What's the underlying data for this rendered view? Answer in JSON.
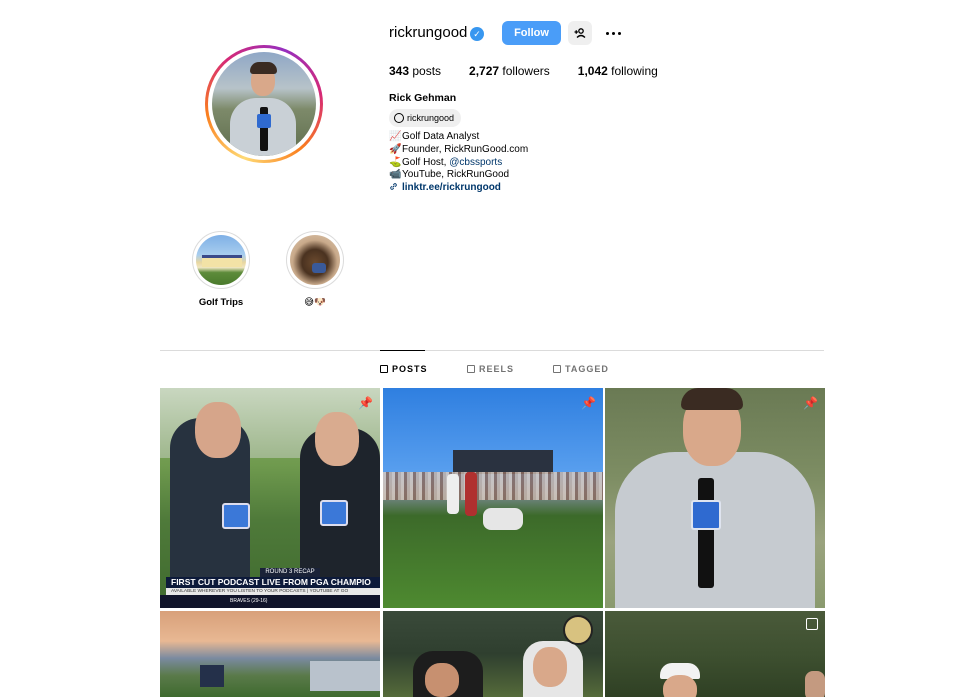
{
  "profile": {
    "username": "rickrungood",
    "follow_label": "Follow",
    "stats": {
      "posts_count": "343",
      "posts_label": " posts",
      "followers_count": "2,727",
      "followers_label": " followers",
      "following_count": "1,042",
      "following_label": " following"
    },
    "full_name": "Rick Gehman",
    "threads_handle": "rickrungood",
    "bio": [
      {
        "emoji": "📈",
        "text": "Golf Data Analyst"
      },
      {
        "emoji": "🚀",
        "text": "Founder, RickRunGood.com"
      },
      {
        "emoji": "⛳",
        "text": "Golf Host, ",
        "mention": "@cbssports"
      },
      {
        "emoji": "📹",
        "text": "YouTube, RickRunGood"
      }
    ],
    "link": "linktr.ee/rickrungood"
  },
  "highlights": [
    {
      "label": "Golf Trips"
    },
    {
      "label": "😅🐶"
    }
  ],
  "tabs": {
    "posts": "POSTS",
    "reels": "REELS",
    "tagged": "TAGGED"
  },
  "posts": [
    {
      "overlay_top": "ROUND 3 RECAP",
      "overlay_main": "FIRST CUT PODCAST LIVE FROM PGA CHAMPIO",
      "overlay_sub": "AVAILABLE WHEREVER YOU LISTEN TO YOUR PODCASTS | YOUTUBE AT GO",
      "ticker": "BRAVES (29-16)",
      "pinned": true
    },
    {
      "pinned": true
    },
    {
      "pinned": true
    },
    {
      "pinned": false
    },
    {
      "pinned": false
    },
    {
      "pinned": false,
      "multi": true
    }
  ],
  "colors": {
    "follow_button": "#4a9df8",
    "verified": "#3897f0",
    "link": "#00376b"
  }
}
